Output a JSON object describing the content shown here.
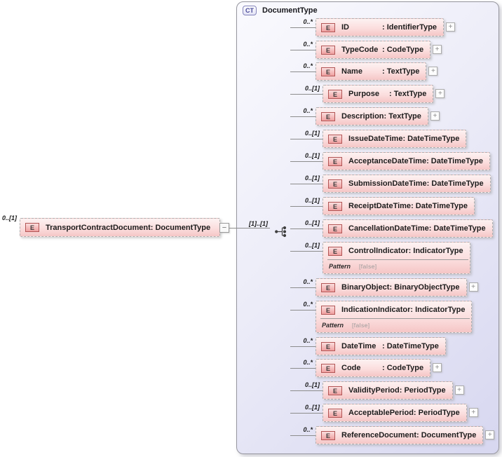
{
  "diagram": {
    "element_icon_label": "E",
    "expand_glyph": "+",
    "collapse_glyph": "−",
    "root_element": {
      "multiplicity": "0..[1]",
      "name": "TransportContractDocument",
      "type": "DocumentType"
    },
    "complex_type": {
      "badge": "CT",
      "title": "DocumentType",
      "connector_multiplicity": "[1]..[1]",
      "model_group": "sequence"
    },
    "children": [
      {
        "multiplicity": "0..*",
        "name": "ID",
        "type": "IdentifierType",
        "expandable": true
      },
      {
        "multiplicity": "0..*",
        "name": "TypeCode",
        "type": "CodeType",
        "expandable": true
      },
      {
        "multiplicity": "0..*",
        "name": "Name",
        "type": "TextType",
        "expandable": true
      },
      {
        "multiplicity": "0..[1]",
        "name": "Purpose",
        "type": "TextType",
        "expandable": true
      },
      {
        "multiplicity": "0..*",
        "name": "Description",
        "type": "TextType",
        "expandable": true
      },
      {
        "multiplicity": "0..[1]",
        "name": "IssueDateTime",
        "type": "DateTimeType",
        "expandable": false
      },
      {
        "multiplicity": "0..[1]",
        "name": "AcceptanceDateTime",
        "type": "DateTimeType",
        "expandable": false
      },
      {
        "multiplicity": "0..[1]",
        "name": "SubmissionDateTime",
        "type": "DateTimeType",
        "expandable": false
      },
      {
        "multiplicity": "0..[1]",
        "name": "ReceiptDateTime",
        "type": "DateTimeType",
        "expandable": false
      },
      {
        "multiplicity": "0..[1]",
        "name": "CancellationDateTime",
        "type": "DateTimeType",
        "expandable": false
      },
      {
        "multiplicity": "0..[1]",
        "name": "ControlIndicator",
        "type": "IndicatorType",
        "expandable": false,
        "facets": [
          {
            "label": "Pattern",
            "value": "[false]"
          }
        ]
      },
      {
        "multiplicity": "0..*",
        "name": "BinaryObject",
        "type": "BinaryObjectType",
        "expandable": true
      },
      {
        "multiplicity": "0..*",
        "name": "IndicationIndicator",
        "type": "IndicatorType",
        "expandable": false,
        "facets": [
          {
            "label": "Pattern",
            "value": "[false]"
          }
        ]
      },
      {
        "multiplicity": "0..*",
        "name": "DateTime",
        "type": "DateTimeType",
        "expandable": false
      },
      {
        "multiplicity": "0..*",
        "name": "Code",
        "type": "CodeType",
        "expandable": true
      },
      {
        "multiplicity": "0..[1]",
        "name": "ValidityPeriod",
        "type": "PeriodType",
        "expandable": true
      },
      {
        "multiplicity": "0..[1]",
        "name": "AcceptablePeriod",
        "type": "PeriodType",
        "expandable": true
      },
      {
        "multiplicity": "0..*",
        "name": "ReferenceDocument",
        "type": "DocumentType",
        "expandable": true
      }
    ],
    "colors": {
      "element_fill_top": "#fdf2f2",
      "element_fill_bottom": "#f5c6c6",
      "element_icon_border": "#b25555",
      "container_fill_top": "#fafafe",
      "container_fill_bottom": "#d7d7f0",
      "badge_accent": "#4a4a99",
      "connector": "#8c8c8c"
    }
  }
}
